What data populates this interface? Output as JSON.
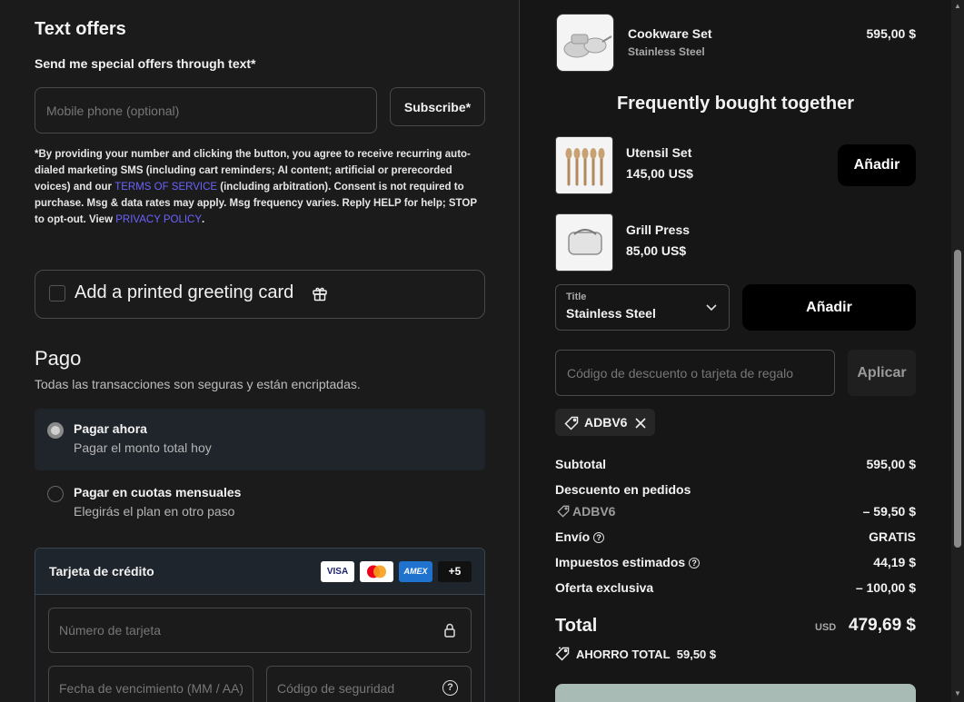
{
  "offers": {
    "title": "Text offers",
    "subtitle": "Send me special offers through text*",
    "phone_placeholder": "Mobile phone (optional)",
    "subscribe_label": "Subscribe*",
    "disclaimer_1": "*By providing your number and clicking the button, you agree to receive recurring auto-dialed marketing SMS (including cart reminders; AI content; artificial or prerecorded voices) and our ",
    "terms_link": "TERMS OF SERVICE",
    "disclaimer_2": " (including arbitration). Consent is not required to purchase. Msg & data rates may apply. Msg frequency varies. Reply HELP for help; STOP to opt-out. View ",
    "privacy_link": "PRIVACY POLICY",
    "disclaimer_3": "."
  },
  "greeting": {
    "label": "Add a printed greeting card",
    "checked": false
  },
  "payment": {
    "title": "Pago",
    "subtitle": "Todas las transacciones son seguras y están encriptadas.",
    "options": [
      {
        "title": "Pagar ahora",
        "subtitle": "Pagar el monto total hoy",
        "selected": true
      },
      {
        "title": "Pagar en cuotas mensuales",
        "subtitle": "Elegirás el plan en otro paso",
        "selected": false
      }
    ],
    "card": {
      "title": "Tarjeta de crédito",
      "brands": [
        "VISA",
        "Mastercard",
        "AMEX",
        "+5"
      ],
      "number_placeholder": "Número de tarjeta",
      "expiry_placeholder": "Fecha de vencimiento (MM / AA)",
      "cvc_placeholder": "Código de seguridad"
    }
  },
  "cart": {
    "item": {
      "name": "Cookware Set",
      "variant": "Stainless Steel",
      "price": "595,00 $"
    },
    "fbt_title": "Frequently bought together",
    "fbt": [
      {
        "name": "Utensil Set",
        "price": "145,00 US$",
        "button": "Añadir"
      },
      {
        "name": "Grill Press",
        "price": "85,00 US$"
      }
    ],
    "select_label": "Title",
    "select_value": "Stainless Steel",
    "add_label": "Añadir",
    "discount_placeholder": "Código de descuento o tarjeta de regalo",
    "apply_label": "Aplicar",
    "applied_code": "ADBV6"
  },
  "summary": {
    "subtotal_label": "Subtotal",
    "subtotal": "595,00 $",
    "order_discount_label": "Descuento en pedidos",
    "discount_code": "ADBV6",
    "discount_value": "– 59,50 $",
    "shipping_label": "Envío",
    "shipping_value": "GRATIS",
    "tax_label": "Impuestos estimados",
    "tax_value": "44,19 $",
    "exclusive_label": "Oferta exclusiva",
    "exclusive_value": "– 100,00 $",
    "total_label": "Total",
    "currency": "USD",
    "total_value": "479,69 $",
    "savings_label": "AHORRO TOTAL",
    "savings_value": "59,50 $"
  },
  "colors": {
    "link": "#6c63ff",
    "background": "#1b1b1b",
    "pay_button": "#a9bbb5"
  }
}
